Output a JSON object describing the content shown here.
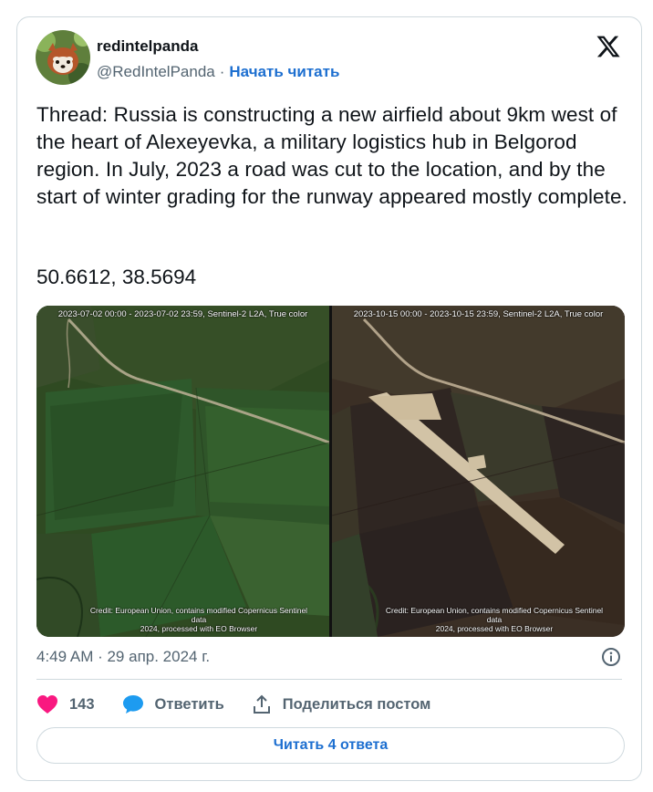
{
  "author": {
    "display_name": "redintelpanda",
    "handle": "@RedIntelPanda",
    "separator": "·",
    "follow_label": "Начать читать"
  },
  "tweet": {
    "text": "Thread: Russia is constructing a new airfield about 9km west of the heart of Alexeyevka, a military logistics hub in Belgorod region. In July, 2023 a road was cut to the location, and by the start of winter grading for the runway appeared mostly complete.",
    "coordinates": "50.6612, 38.5694"
  },
  "media": {
    "images": [
      {
        "caption_top": "2023-07-02 00:00 - 2023-07-02 23:59, Sentinel-2 L2A, True color",
        "caption_bottom_line1": "Credit: European Union, contains modified Copernicus Sentinel data",
        "caption_bottom_line2": "2024, processed with EO Browser"
      },
      {
        "caption_top": "2023-10-15 00:00 - 2023-10-15 23:59, Sentinel-2 L2A, True color",
        "caption_bottom_line1": "Credit: European Union, contains modified Copernicus Sentinel data",
        "caption_bottom_line2": "2024, processed with EO Browser"
      }
    ]
  },
  "meta": {
    "timestamp": "4:49 AM · 29 апр. 2024 г."
  },
  "actions": {
    "like_count": "143",
    "reply_label": "Ответить",
    "share_label": "Поделиться постом"
  },
  "read_replies_label": "Читать 4 ответа",
  "colors": {
    "link": "#1d6fd0",
    "like": "#f91880",
    "reply_icon": "#1d9bf0",
    "muted": "#536471",
    "border": "#cfd9de"
  },
  "icons": {
    "logo": "x-logo-icon",
    "info": "info-icon",
    "like": "heart-icon",
    "reply": "speech-bubble-icon",
    "share": "share-upload-icon"
  }
}
